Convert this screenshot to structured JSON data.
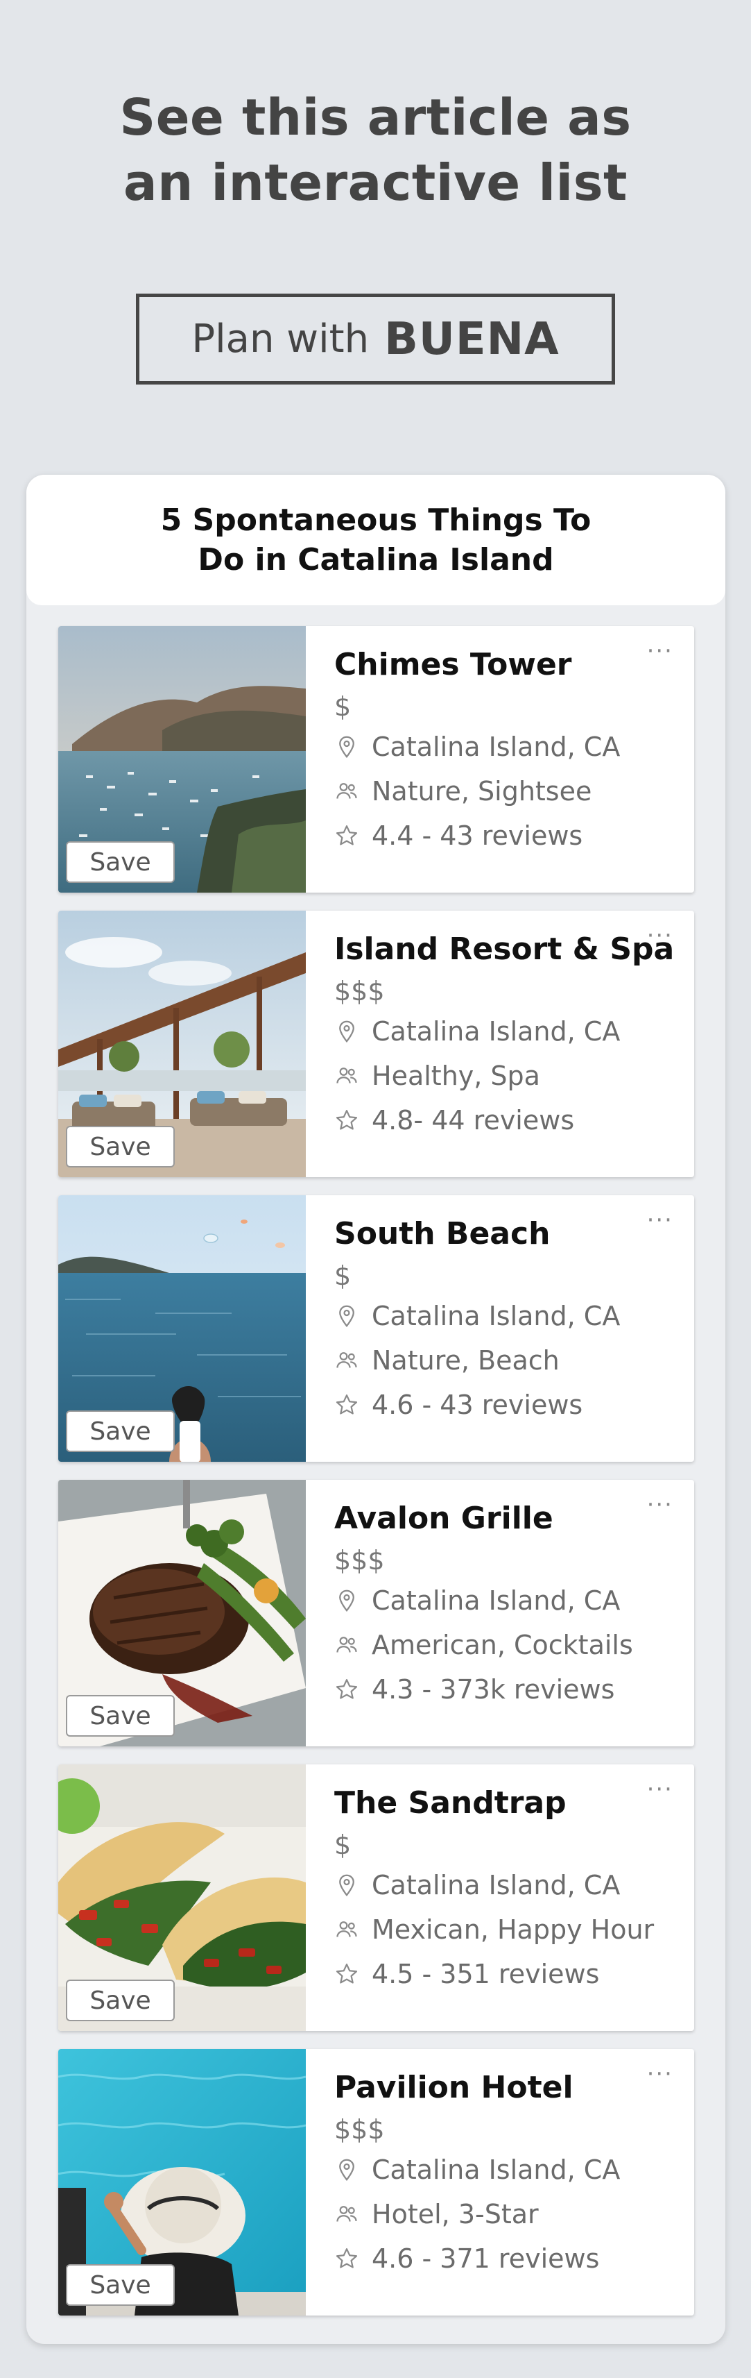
{
  "hero": {
    "line1": "See this article as",
    "line2": "an interactive list"
  },
  "plan_button": {
    "prefix": "Plan with",
    "brand": "BUENA"
  },
  "list": {
    "title_line1": "5 Spontaneous Things To",
    "title_line2": "Do in Catalina Island",
    "save_label": "Save",
    "more_label": "···",
    "items": [
      {
        "name": "Chimes Tower",
        "price": "$",
        "location": "Catalina Island, CA",
        "tags": "Nature, Sightsee",
        "rating": "4.4 - 43 reviews"
      },
      {
        "name": "Island Resort & Spa",
        "price": "$$$",
        "location": "Catalina Island, CA",
        "tags": "Healthy, Spa",
        "rating": "4.8- 44 reviews"
      },
      {
        "name": "South Beach",
        "price": "$",
        "location": "Catalina Island, CA",
        "tags": "Nature, Beach",
        "rating": "4.6 - 43 reviews"
      },
      {
        "name": "Avalon Grille",
        "price": "$$$",
        "location": "Catalina Island, CA",
        "tags": "American, Cocktails",
        "rating": "4.3 - 373k reviews"
      },
      {
        "name": "The Sandtrap",
        "price": "$",
        "location": "Catalina Island, CA",
        "tags": "Mexican, Happy Hour",
        "rating": "4.5 - 351 reviews"
      },
      {
        "name": "Pavilion Hotel",
        "price": "$$$",
        "location": "Catalina Island, CA",
        "tags": "Hotel, 3-Star",
        "rating": "4.6 - 371 reviews"
      }
    ]
  },
  "icons": {
    "location": "map-pin-icon",
    "tags": "people-icon",
    "rating": "star-outline-icon",
    "more": "ellipsis-icon"
  },
  "colors": {
    "page_background": "#e3e6ea",
    "heading_text": "#444444",
    "card_background": "#ffffff",
    "secondary_text": "#6b6b6b"
  }
}
